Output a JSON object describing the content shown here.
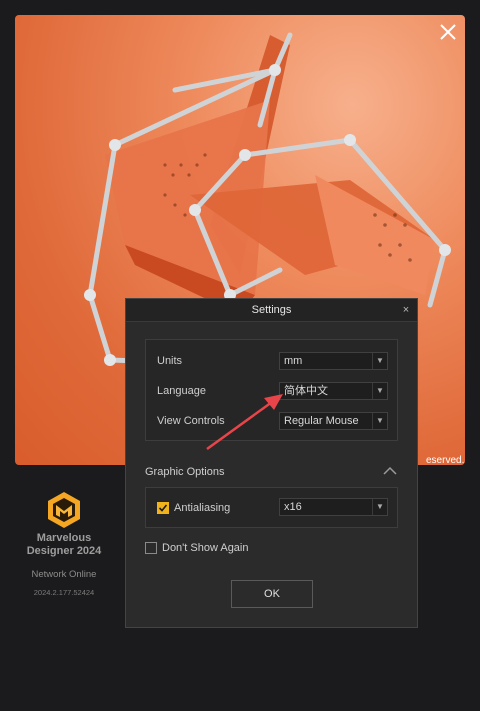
{
  "splash": {
    "copyright_text": "eserved.",
    "close_icon": "close-x-icon"
  },
  "brand": {
    "logo_icon": "marvelous-designer-logo",
    "name_line1": "Marvelous",
    "name_line2": "Designer 2024",
    "network_status": "Network Online",
    "version": "2024.2.177.52424",
    "logo_colors": {
      "outer": "#f5a623",
      "inner": "#e2831f"
    }
  },
  "dialog": {
    "title": "Settings",
    "close_glyph": "×",
    "general": {
      "units": {
        "label": "Units",
        "value": "mm"
      },
      "language": {
        "label": "Language",
        "value": "简体中文"
      },
      "view_controls": {
        "label": "View Controls",
        "value": "Regular Mouse"
      }
    },
    "graphic_options": {
      "title": "Graphic Options",
      "antialiasing": {
        "label": "Antialiasing",
        "checked": true,
        "value": "x16"
      }
    },
    "dont_show_again": {
      "label": "Don't Show Again",
      "checked": false
    },
    "ok_label": "OK"
  },
  "colors": {
    "accent_checkbox": "#f0b31c",
    "annotation_arrow": "#e8454a",
    "splash_orange": "#e06a3a"
  }
}
